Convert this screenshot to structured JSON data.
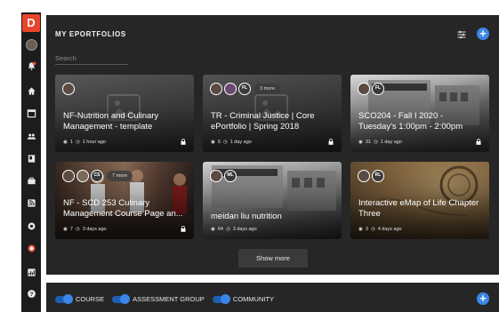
{
  "app": {
    "logo_letter": "D"
  },
  "sidebar": {
    "icons": [
      "avatar",
      "notifications-icon",
      "home-icon",
      "calendar-icon",
      "groups-icon",
      "portfolio-icon",
      "briefcase-icon",
      "rss-icon",
      "settings-icon",
      "badge-icon",
      "chart-icon",
      "help-icon"
    ]
  },
  "main": {
    "title": "MY EPORTFOLIOS",
    "search_placeholder": "Search",
    "add_label": "+",
    "show_more": "Show more"
  },
  "cards": [
    {
      "title": "NF-Nutrition and Culinary Management - template",
      "views": "1",
      "time": "1 hour ago",
      "avatars": [],
      "more": "",
      "image": "placeholder"
    },
    {
      "title": "TR - Criminal Justice | Core ePortfolio | Spring 2018",
      "views": "6",
      "time": "1 day ago",
      "avatars": [
        "FL"
      ],
      "more": "3 more",
      "image": "placeholder"
    },
    {
      "title": "SCO204 - Fall I 2020 - Tuesday's 1:00pm - 2:00pm",
      "views": "31",
      "time": "1 day ago",
      "avatars": [
        "FL"
      ],
      "more": "",
      "image": "building"
    },
    {
      "title": "NF - SCD 253 Culinary Management Course Page an...",
      "views": "7",
      "time": "3 days ago",
      "avatars": [
        "CS"
      ],
      "more": "7 more",
      "image": "kitchen"
    },
    {
      "title": "meidan liu nutrition",
      "views": "64",
      "time": "3 days ago",
      "avatars": [
        "ML"
      ],
      "more": "",
      "image": "building"
    },
    {
      "title": "Interactive eMap of Life Chapter Three",
      "views": "3",
      "time": "4 days ago",
      "avatars": [
        "RL"
      ],
      "more": "",
      "image": "map"
    }
  ],
  "bottom": {
    "toggles": [
      "COURSE",
      "ASSESSMENT GROUP",
      "COMMUNITY"
    ],
    "add_label": "+"
  },
  "colors": {
    "accent": "#3a86e8",
    "logo": "#e8452c",
    "panel": "#262626",
    "sidebar": "#1c1c1c"
  }
}
